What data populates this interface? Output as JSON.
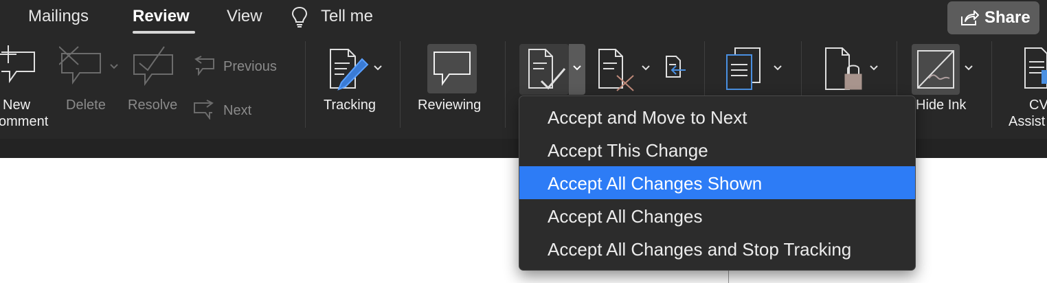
{
  "tabs": {
    "mailings": "Mailings",
    "review": "Review",
    "view": "View",
    "tell_me": "Tell me"
  },
  "share": {
    "label": "Share"
  },
  "ribbon": {
    "new_comment_line1": "New",
    "new_comment_line2": "omment",
    "delete": "Delete",
    "resolve": "Resolve",
    "previous": "Previous",
    "next": "Next",
    "tracking": "Tracking",
    "reviewing": "Reviewing",
    "hide_ink": "Hide Ink",
    "cv_line1": "CV",
    "cv_line2": "Assist"
  },
  "accept_menu": {
    "items": [
      "Accept and Move to Next",
      "Accept This Change",
      "Accept All Changes Shown",
      "Accept All Changes",
      "Accept All Changes and Stop Tracking"
    ],
    "selected_index": 2
  },
  "colors": {
    "ribbon_background": "#282828",
    "menu_highlight": "#2d7cf6",
    "share_button": "#5c5c5c"
  }
}
